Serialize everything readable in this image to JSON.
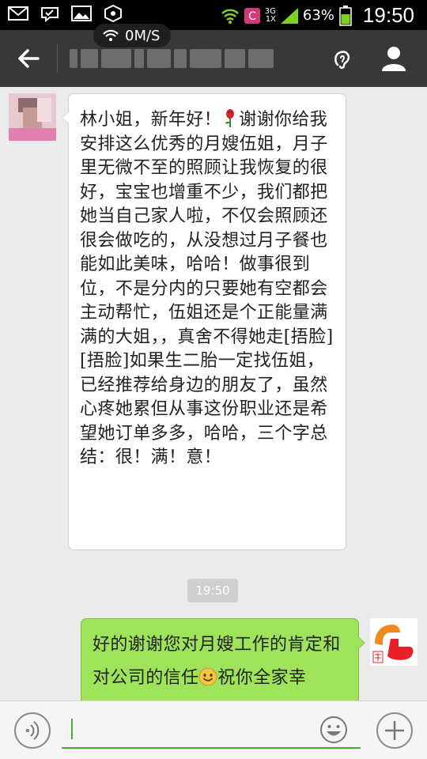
{
  "status_bar": {
    "icons_left": [
      "mail-icon",
      "sync-chat-icon",
      "image-icon",
      "hexagon-icon"
    ],
    "network_type_top": "3G",
    "network_type_bottom": "1X",
    "battery_percent": "63%",
    "time": "19:50",
    "speed": "0M/S"
  },
  "title_bar": {
    "back_icon": "arrow-left-icon",
    "earpiece_icon": "ear-icon",
    "profile_icon": "person-icon"
  },
  "chat": {
    "incoming": {
      "text_part1": "林小姐，新年好！",
      "text_part2": "谢谢你给我安排这么优秀的月嫂伍姐，月子里无微不至的照顾让我恢复的很好，宝宝也增重不少，我们都把她当自己家人啦，不仅会照顾还很会做吃的，从没想过月子餐也能如此美味，哈哈！做事很到位，不是分内的只要她有空都会主动帮忙，伍姐还是个正能量满满的大姐，，真舍不得她走[捂脸][捂脸]如果生二胎一定找伍姐，已经推荐给身边的朋友了，虽然心疼她累但从事这份职业还是希望她订单多多，哈哈，三个字总结：很！满！意！"
    },
    "timestamp": "19:50",
    "outgoing": {
      "text_part1": "好的谢谢您对月嫂工作的肯定和对公司的信任",
      "text_part2": "祝你全家幸"
    }
  },
  "colors": {
    "title_bar_bg": "#383838",
    "chat_bg": "#ebebeb",
    "outgoing_bubble": "#9ee35a",
    "accent_green": "#45b035"
  }
}
